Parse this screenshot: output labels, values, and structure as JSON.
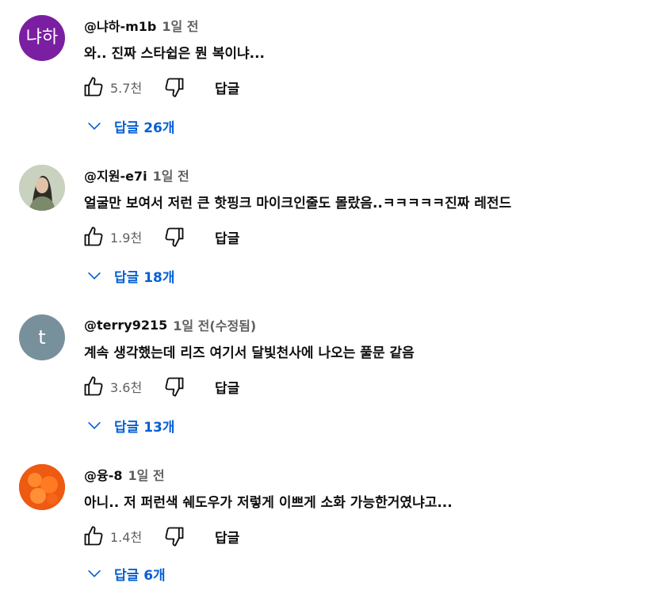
{
  "comments": [
    {
      "avatar_text": "냐하",
      "avatar_color": "#7b1fa2",
      "handle": "@냐하-m1b",
      "time": "1일 전",
      "edited": "",
      "text": "와.. 진짜 스타쉽은 뭔 복이냐...",
      "likes": "5.7천",
      "reply_label": "답글",
      "replies_label": "답글 26개"
    },
    {
      "avatar_text": "",
      "avatar_color": "#8a8f7c",
      "handle": "@지원-e7i",
      "time": "1일 전",
      "edited": "",
      "text": "얼굴만 보여서 저런 큰 핫핑크 마이크인줄도 몰랐음..ㅋㅋㅋㅋㅋ진짜 레전드",
      "likes": "1.9천",
      "reply_label": "답글",
      "replies_label": "답글 18개"
    },
    {
      "avatar_text": "t",
      "avatar_color": "#78909c",
      "handle": "@terry9215",
      "time": "1일 전",
      "edited": "(수정됨)",
      "text": "계속 생각했는데 리즈 여기서 달빛천사에 나오는 풀문 같음",
      "likes": "3.6천",
      "reply_label": "답글",
      "replies_label": "답글 13개"
    },
    {
      "avatar_text": "",
      "avatar_color": "#f2520d",
      "handle": "@융-8",
      "time": "1일 전",
      "edited": "",
      "text": "아니.. 저 퍼런색 쉐도우가 저렇게 이쁘게 소화 가능한거였냐고...",
      "likes": "1.4천",
      "reply_label": "답글",
      "replies_label": "답글 6개"
    }
  ],
  "icons": {
    "like": "thumbs-up-icon",
    "dislike": "thumbs-down-icon",
    "expand": "chevron-down-icon"
  },
  "colors": {
    "link_blue": "#065fd4",
    "secondary_text": "#606060"
  }
}
